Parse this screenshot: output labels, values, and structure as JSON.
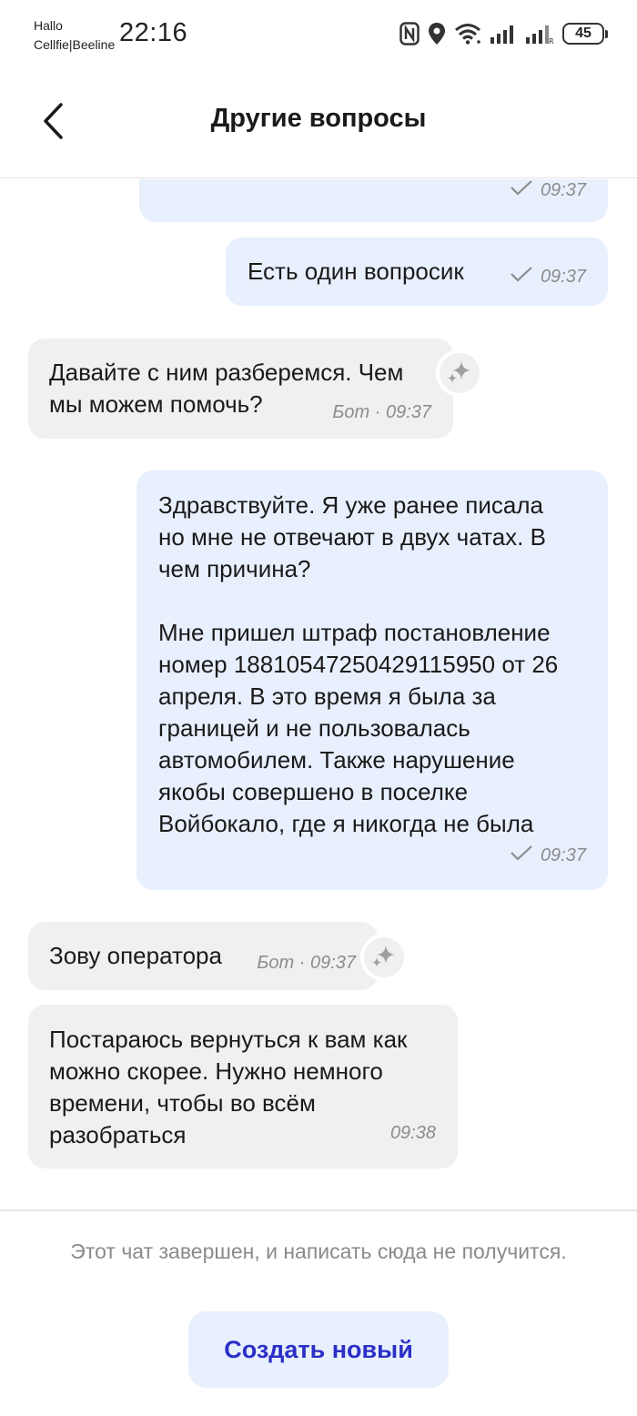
{
  "status_bar": {
    "carrier_line1": "Hallo",
    "carrier_line2": "Cellfie|Beeline",
    "time": "22:16",
    "battery": "45",
    "icons": [
      "nfc-icon",
      "location-icon",
      "wifi-icon",
      "signal-icon",
      "signal-roaming-icon",
      "battery-icon"
    ]
  },
  "header": {
    "title": "Другие вопросы",
    "back_icon": "chevron-left-icon"
  },
  "messages": [
    {
      "side": "out",
      "text": "",
      "time": "09:37",
      "status": "sent"
    },
    {
      "side": "out",
      "text": "Есть один вопросик",
      "time": "09:37",
      "status": "sent"
    },
    {
      "side": "in",
      "text": "Давайте с ним разберемся. Чем\nмы можем помочь?",
      "meta": "Бот · 09:37",
      "bot": true
    },
    {
      "side": "out",
      "text": "Здравствуйте. Я уже ранее писала\nно мне не отвечают в двух чатах. В\nчем причина?\n\nМне пришел штраф постановление\nномер 18810547250429115950 от 26\nапреля. В это время я была за\nграницей и не пользовалась\nавтомобилем.  Также нарушение\nякобы совершено в поселке\nВойбокало, где я никогда не была",
      "time": "09:37",
      "status": "sent"
    },
    {
      "side": "in",
      "text": "Зову оператора",
      "meta": "Бот · 09:37",
      "bot": true
    },
    {
      "side": "in",
      "text": "Постараюсь вернуться к вам как\nможно скорее. Нужно немного\nвремени, чтобы во всём\nразобраться",
      "meta": "09:38",
      "bot": false
    }
  ],
  "footer": {
    "closed_note": "Этот чат завершен, и написать сюда не получится.",
    "new_button": "Создать новый"
  },
  "colors": {
    "outgoing_bubble": "#e8effd",
    "incoming_bubble": "#f0f0f0",
    "accent_text": "#2b2fc7"
  }
}
